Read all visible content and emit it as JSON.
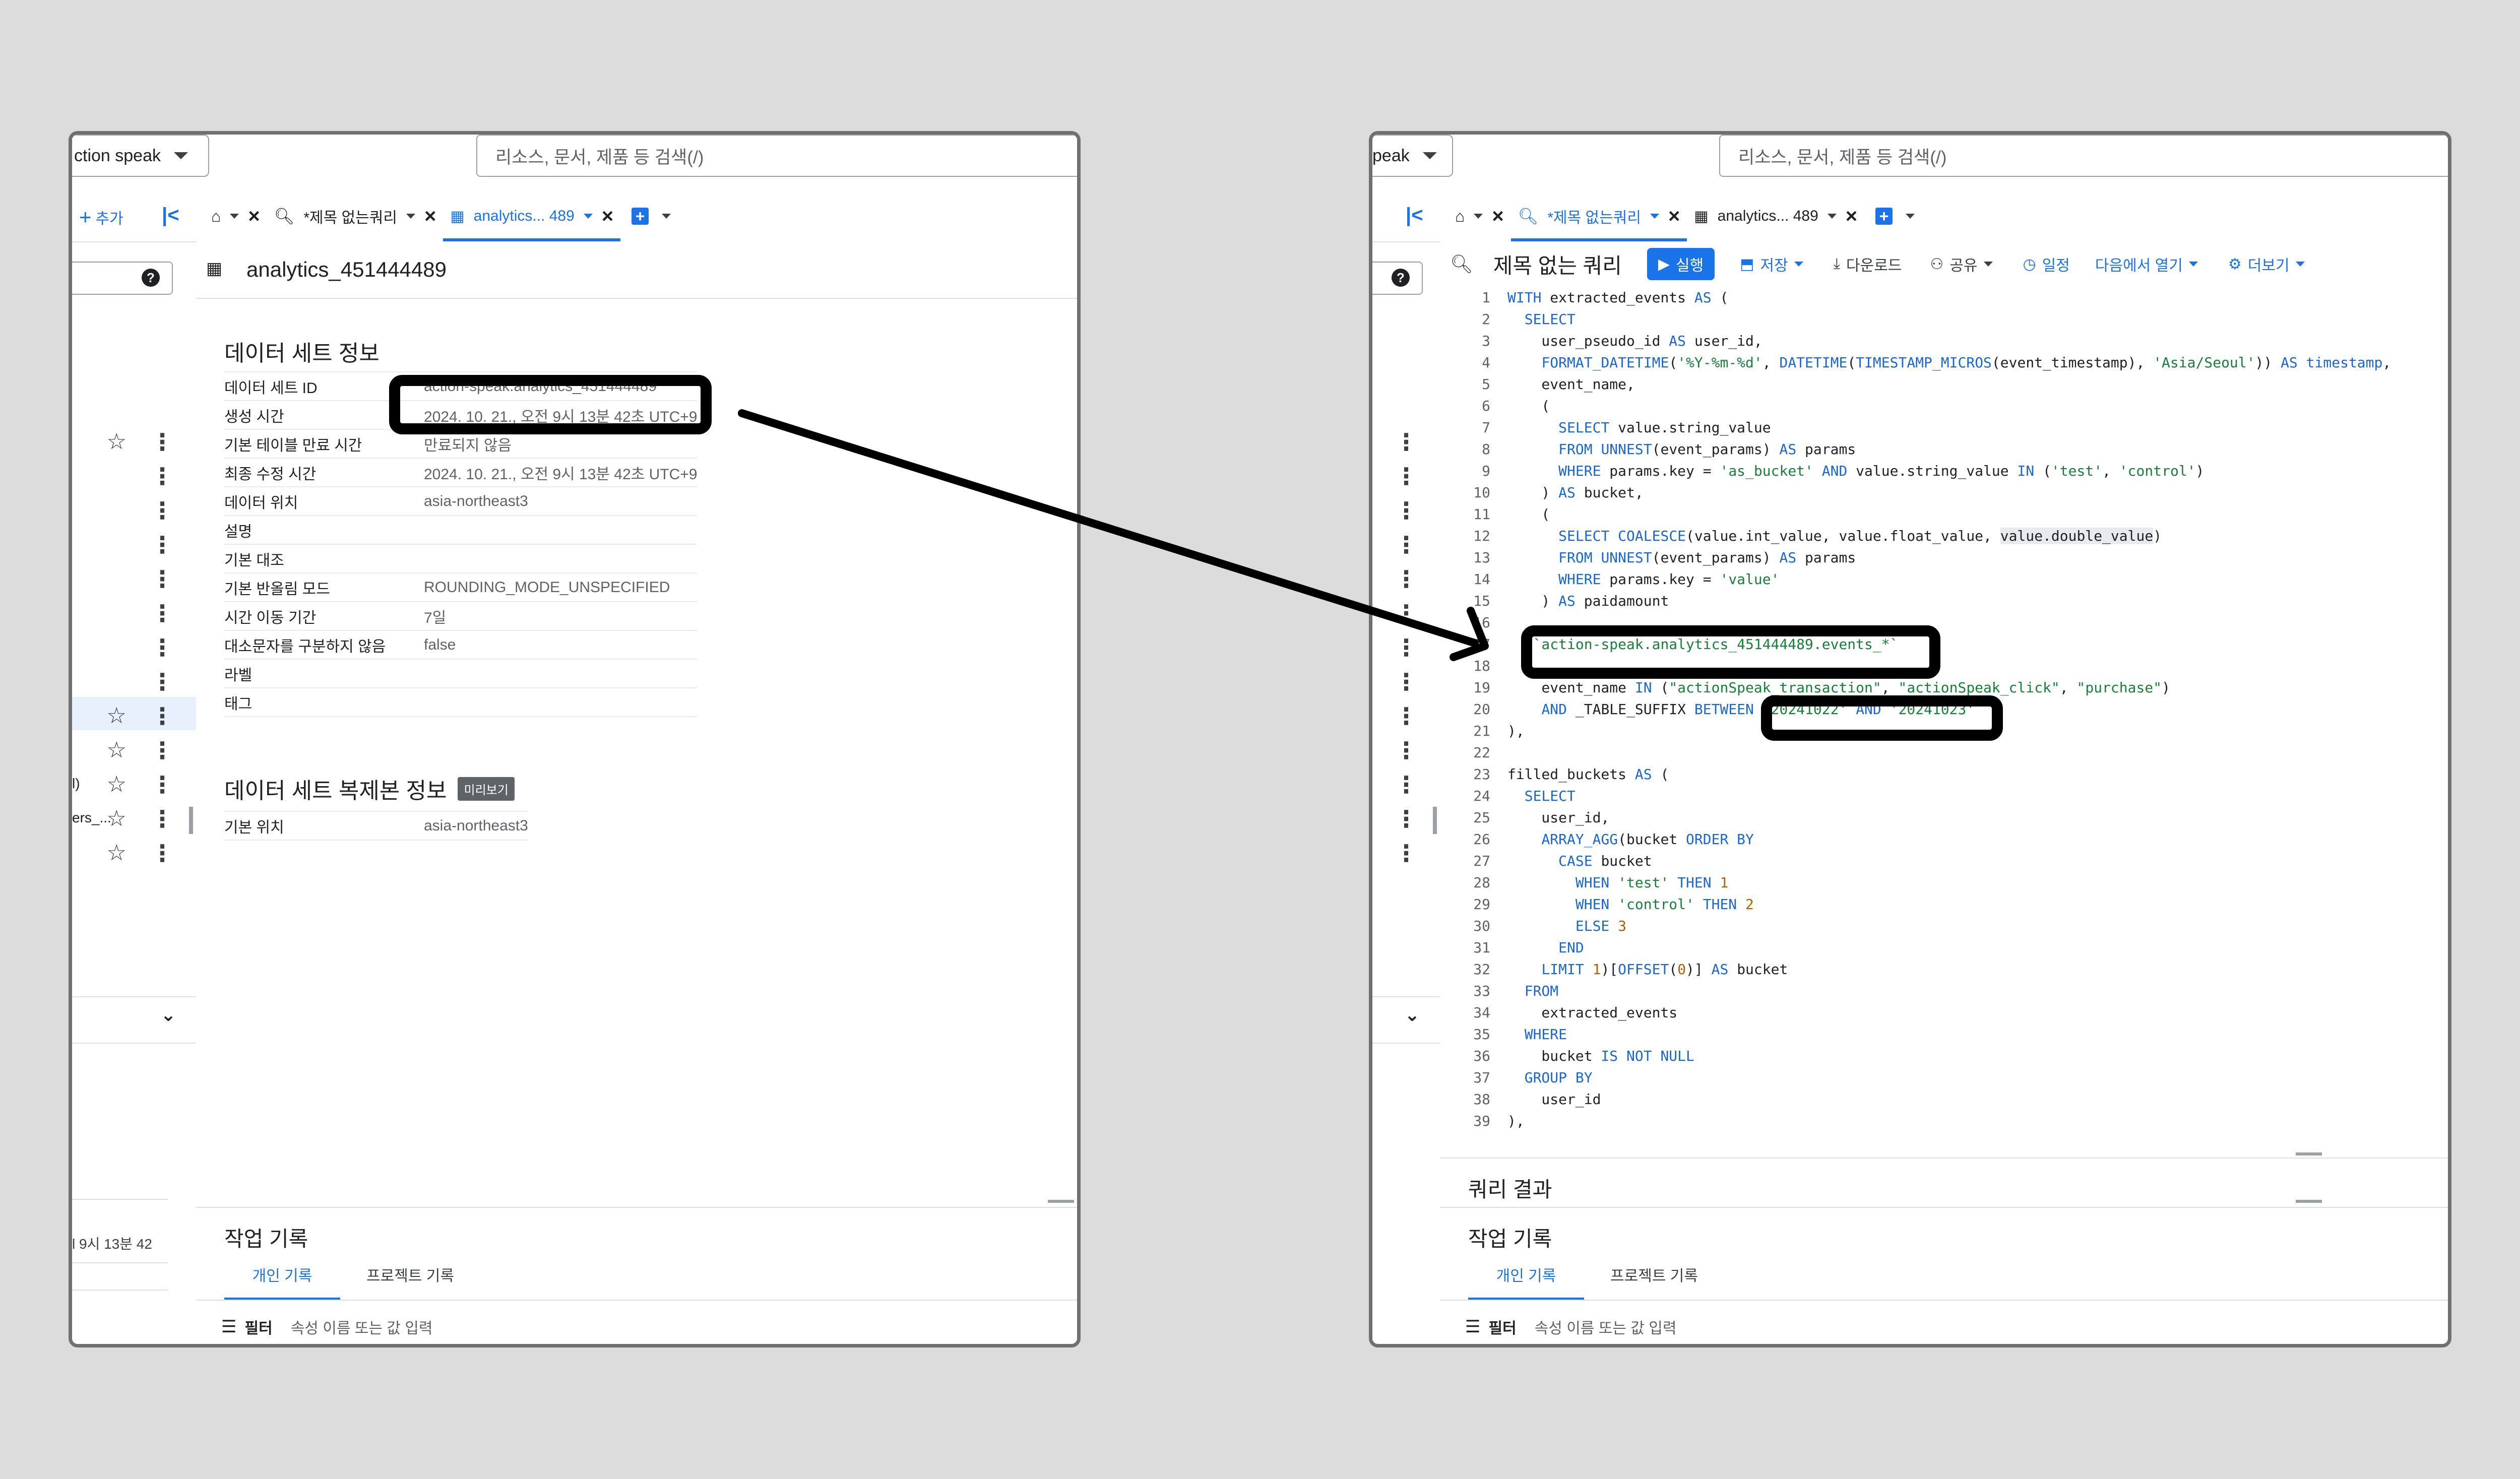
{
  "search": {
    "placeholder": "리소스, 문서, 제품 등 검색(/)"
  },
  "left": {
    "project": "ction speak",
    "add_label": "추가",
    "tabs": [
      {
        "label": "*제목 없는쿼리"
      },
      {
        "label": "analytics... 489"
      }
    ],
    "sidebar_fragments": [
      "l)",
      "ers_...",
      "l 9시 13분 42"
    ],
    "dataset_title": "analytics_451444489",
    "section_info": "데이터 세트 정보",
    "info_rows": [
      {
        "k": "데이터 세트 ID",
        "v": "action-speak.analytics_451444489"
      },
      {
        "k": "생성 시간",
        "v": "2024. 10. 21., 오전 9시 13분 42초 UTC+9"
      },
      {
        "k": "기본 테이블 만료 시간",
        "v": "만료되지 않음"
      },
      {
        "k": "최종 수정 시간",
        "v": "2024. 10. 21., 오전 9시 13분 42초 UTC+9"
      },
      {
        "k": "데이터 위치",
        "v": "asia-northeast3"
      },
      {
        "k": "설명",
        "v": ""
      },
      {
        "k": "기본 대조",
        "v": ""
      },
      {
        "k": "기본 반올림 모드",
        "v": "ROUNDING_MODE_UNSPECIFIED"
      },
      {
        "k": "시간 이동 기간",
        "v": "7일"
      },
      {
        "k": "대소문자를 구분하지 않음",
        "v": "false"
      },
      {
        "k": "라벨",
        "v": ""
      },
      {
        "k": "태그",
        "v": ""
      }
    ],
    "section_replica": "데이터 세트 복제본 정보",
    "preview_badge": "미리보기",
    "replica_rows": [
      {
        "k": "기본 위치",
        "v": "asia-northeast3"
      }
    ],
    "history_title": "작업 기록",
    "history_tabs": [
      "개인 기록",
      "프로젝트 기록"
    ],
    "filter_label": "필터",
    "filter_placeholder": "속성 이름 또는 값 입력"
  },
  "right": {
    "project": "peak",
    "tabs": [
      {
        "label": "*제목 없는쿼리"
      },
      {
        "label": "analytics... 489"
      }
    ],
    "query_title": "제목 없는 쿼리",
    "toolbar": {
      "run": "실행",
      "save": "저장",
      "download": "다운로드",
      "share": "공유",
      "schedule": "일정",
      "open_in": "다음에서 열기",
      "more": "더보기"
    },
    "code_lines": [
      "WITH extracted_events AS (",
      "  SELECT",
      "    user_pseudo_id AS user_id,",
      "    FORMAT_DATETIME('%Y-%m-%d', DATETIME(TIMESTAMP_MICROS(event_timestamp), 'Asia/Seoul')) AS timestamp,",
      "    event_name,",
      "    (",
      "      SELECT value.string_value",
      "      FROM UNNEST(event_params) AS params",
      "      WHERE params.key = 'as_bucket' AND value.string_value IN ('test', 'control')",
      "    ) AS bucket,",
      "    (",
      "      SELECT COALESCE(value.int_value, value.float_value, value.double_value)",
      "      FROM UNNEST(event_params) AS params",
      "      WHERE params.key = 'value'",
      "    ) AS paidamount",
      "",
      "   `action-speak.analytics_451444489.events_*`",
      "",
      "    event_name IN (\"actionSpeak_transaction\", \"actionSpeak_click\", \"purchase\")",
      "    AND _TABLE_SUFFIX BETWEEN '20241022' AND '20241023'",
      "),",
      "",
      "filled_buckets AS (",
      "  SELECT",
      "    user_id,",
      "    ARRAY_AGG(bucket ORDER BY",
      "      CASE bucket",
      "        WHEN 'test' THEN 1",
      "        WHEN 'control' THEN 2",
      "        ELSE 3",
      "      END",
      "    LIMIT 1)[OFFSET(0)] AS bucket",
      "  FROM",
      "    extracted_events",
      "  WHERE",
      "    bucket IS NOT NULL",
      "  GROUP BY",
      "    user_id",
      "),"
    ],
    "results_title": "쿼리 결과",
    "history_title": "작업 기록",
    "history_tabs": [
      "개인 기록",
      "프로젝트 기록"
    ],
    "filter_label": "필터",
    "filter_placeholder": "속성 이름 또는 값 입력"
  },
  "colors": {
    "accent": "#1a73e8",
    "highlight": "#000000",
    "background": "#dcdcdc"
  }
}
